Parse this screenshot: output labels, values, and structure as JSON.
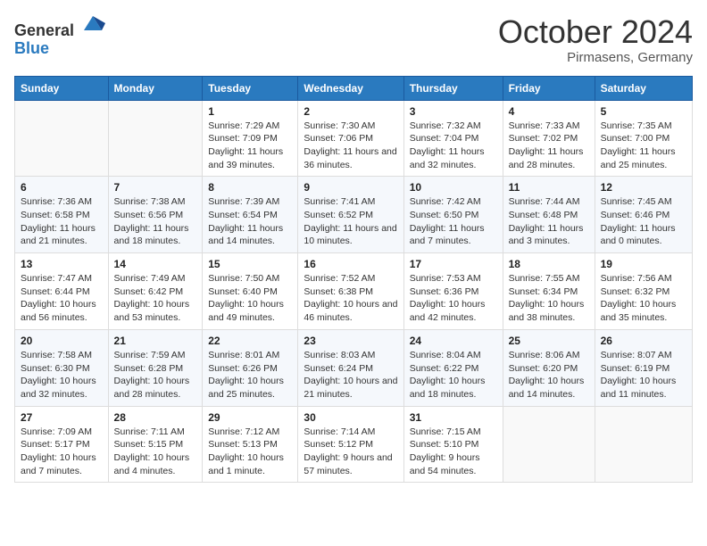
{
  "header": {
    "logo_general": "General",
    "logo_blue": "Blue",
    "title": "October 2024",
    "location": "Pirmasens, Germany"
  },
  "days_of_week": [
    "Sunday",
    "Monday",
    "Tuesday",
    "Wednesday",
    "Thursday",
    "Friday",
    "Saturday"
  ],
  "weeks": [
    [
      {
        "day": "",
        "info": ""
      },
      {
        "day": "",
        "info": ""
      },
      {
        "day": "1",
        "info": "Sunrise: 7:29 AM\nSunset: 7:09 PM\nDaylight: 11 hours and 39 minutes."
      },
      {
        "day": "2",
        "info": "Sunrise: 7:30 AM\nSunset: 7:06 PM\nDaylight: 11 hours and 36 minutes."
      },
      {
        "day": "3",
        "info": "Sunrise: 7:32 AM\nSunset: 7:04 PM\nDaylight: 11 hours and 32 minutes."
      },
      {
        "day": "4",
        "info": "Sunrise: 7:33 AM\nSunset: 7:02 PM\nDaylight: 11 hours and 28 minutes."
      },
      {
        "day": "5",
        "info": "Sunrise: 7:35 AM\nSunset: 7:00 PM\nDaylight: 11 hours and 25 minutes."
      }
    ],
    [
      {
        "day": "6",
        "info": "Sunrise: 7:36 AM\nSunset: 6:58 PM\nDaylight: 11 hours and 21 minutes."
      },
      {
        "day": "7",
        "info": "Sunrise: 7:38 AM\nSunset: 6:56 PM\nDaylight: 11 hours and 18 minutes."
      },
      {
        "day": "8",
        "info": "Sunrise: 7:39 AM\nSunset: 6:54 PM\nDaylight: 11 hours and 14 minutes."
      },
      {
        "day": "9",
        "info": "Sunrise: 7:41 AM\nSunset: 6:52 PM\nDaylight: 11 hours and 10 minutes."
      },
      {
        "day": "10",
        "info": "Sunrise: 7:42 AM\nSunset: 6:50 PM\nDaylight: 11 hours and 7 minutes."
      },
      {
        "day": "11",
        "info": "Sunrise: 7:44 AM\nSunset: 6:48 PM\nDaylight: 11 hours and 3 minutes."
      },
      {
        "day": "12",
        "info": "Sunrise: 7:45 AM\nSunset: 6:46 PM\nDaylight: 11 hours and 0 minutes."
      }
    ],
    [
      {
        "day": "13",
        "info": "Sunrise: 7:47 AM\nSunset: 6:44 PM\nDaylight: 10 hours and 56 minutes."
      },
      {
        "day": "14",
        "info": "Sunrise: 7:49 AM\nSunset: 6:42 PM\nDaylight: 10 hours and 53 minutes."
      },
      {
        "day": "15",
        "info": "Sunrise: 7:50 AM\nSunset: 6:40 PM\nDaylight: 10 hours and 49 minutes."
      },
      {
        "day": "16",
        "info": "Sunrise: 7:52 AM\nSunset: 6:38 PM\nDaylight: 10 hours and 46 minutes."
      },
      {
        "day": "17",
        "info": "Sunrise: 7:53 AM\nSunset: 6:36 PM\nDaylight: 10 hours and 42 minutes."
      },
      {
        "day": "18",
        "info": "Sunrise: 7:55 AM\nSunset: 6:34 PM\nDaylight: 10 hours and 38 minutes."
      },
      {
        "day": "19",
        "info": "Sunrise: 7:56 AM\nSunset: 6:32 PM\nDaylight: 10 hours and 35 minutes."
      }
    ],
    [
      {
        "day": "20",
        "info": "Sunrise: 7:58 AM\nSunset: 6:30 PM\nDaylight: 10 hours and 32 minutes."
      },
      {
        "day": "21",
        "info": "Sunrise: 7:59 AM\nSunset: 6:28 PM\nDaylight: 10 hours and 28 minutes."
      },
      {
        "day": "22",
        "info": "Sunrise: 8:01 AM\nSunset: 6:26 PM\nDaylight: 10 hours and 25 minutes."
      },
      {
        "day": "23",
        "info": "Sunrise: 8:03 AM\nSunset: 6:24 PM\nDaylight: 10 hours and 21 minutes."
      },
      {
        "day": "24",
        "info": "Sunrise: 8:04 AM\nSunset: 6:22 PM\nDaylight: 10 hours and 18 minutes."
      },
      {
        "day": "25",
        "info": "Sunrise: 8:06 AM\nSunset: 6:20 PM\nDaylight: 10 hours and 14 minutes."
      },
      {
        "day": "26",
        "info": "Sunrise: 8:07 AM\nSunset: 6:19 PM\nDaylight: 10 hours and 11 minutes."
      }
    ],
    [
      {
        "day": "27",
        "info": "Sunrise: 7:09 AM\nSunset: 5:17 PM\nDaylight: 10 hours and 7 minutes."
      },
      {
        "day": "28",
        "info": "Sunrise: 7:11 AM\nSunset: 5:15 PM\nDaylight: 10 hours and 4 minutes."
      },
      {
        "day": "29",
        "info": "Sunrise: 7:12 AM\nSunset: 5:13 PM\nDaylight: 10 hours and 1 minute."
      },
      {
        "day": "30",
        "info": "Sunrise: 7:14 AM\nSunset: 5:12 PM\nDaylight: 9 hours and 57 minutes."
      },
      {
        "day": "31",
        "info": "Sunrise: 7:15 AM\nSunset: 5:10 PM\nDaylight: 9 hours and 54 minutes."
      },
      {
        "day": "",
        "info": ""
      },
      {
        "day": "",
        "info": ""
      }
    ]
  ]
}
